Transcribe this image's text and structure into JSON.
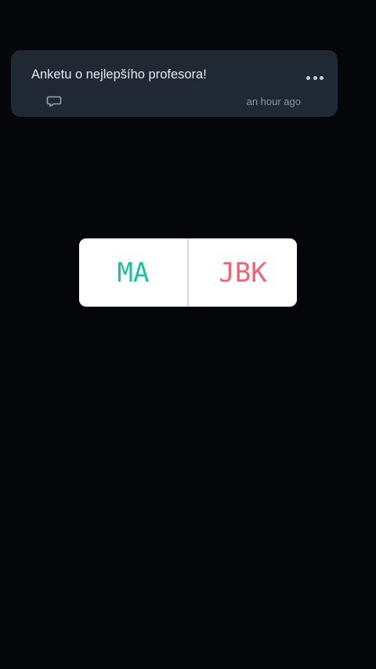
{
  "post": {
    "title": "Anketu o nejlepšího profesora!",
    "timestamp": "an hour ago",
    "icons": {
      "more": "more-dots-icon",
      "comment": "comment-bubble-icon"
    }
  },
  "poll": {
    "options": [
      {
        "label": "MA",
        "color": "#18c2a2"
      },
      {
        "label": "JBK",
        "color": "#ef6474"
      }
    ]
  },
  "colors": {
    "background": "#04060a",
    "card": "#202833",
    "text": "#e6e9ee",
    "meta": "#8d96a3"
  }
}
